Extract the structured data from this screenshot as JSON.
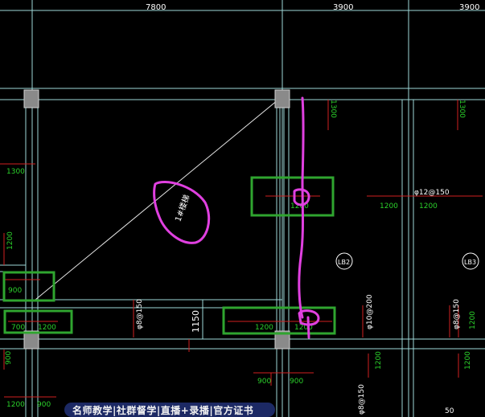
{
  "dimensions": {
    "top_span_1": "7800",
    "top_span_2": "3900",
    "top_span_3": "3900"
  },
  "rebar_labels": {
    "r1300_left": "1300",
    "r1300_top_mid": "1300",
    "r1300_top_right": "1300",
    "r1200_left": "1200",
    "r1200_mid_a": "1200",
    "r1200_mid_b": "1200",
    "r1200_box": "1200",
    "r1200_bottom_a": "1200",
    "r1200_bottom_b": "1200",
    "r1200_right_bottom": "1200",
    "r1200_right_side": "1200",
    "r900_box": "900",
    "r900_bottom_a": "900",
    "r900_bottom_b": "900",
    "r900_left_bottom": "900",
    "r900_far_left": "900",
    "r700_box": "700",
    "r1150": "1150",
    "phi12_150": "φ12@150",
    "phi8_150_left": "φ8@150",
    "phi10_200": "φ10@200",
    "phi8_150_right": "φ8@150",
    "bottom_small_a": "φ8@150",
    "bottom_small_b": "50",
    "annotation_stair": "1#楼梯"
  },
  "slab_tags": {
    "lb2": "LB2",
    "lb3": "LB3"
  },
  "colors": {
    "background": "#000000",
    "axis_cyan": "#9ed8d8",
    "rebar_red": "#d02020",
    "rebar_text_green": "#2bd12b",
    "highlight_box": "#2fa52f",
    "markup_magenta": "#e040e0",
    "column_gray": "#8a8a8a",
    "text_white": "#ffffff"
  },
  "bottom_bar": {
    "label": "名师教学|社群督学|直播+录播|官方证书"
  }
}
